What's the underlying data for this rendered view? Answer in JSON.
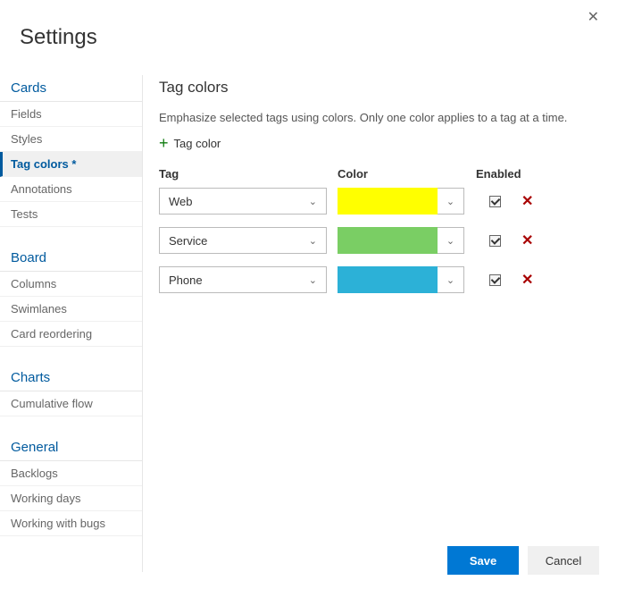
{
  "header": {
    "title": "Settings"
  },
  "close_icon": "✕",
  "sidebar": {
    "sections": [
      {
        "title": "Cards",
        "items": [
          {
            "label": "Fields",
            "active": false
          },
          {
            "label": "Styles",
            "active": false
          },
          {
            "label": "Tag colors *",
            "active": true
          },
          {
            "label": "Annotations",
            "active": false
          },
          {
            "label": "Tests",
            "active": false
          }
        ]
      },
      {
        "title": "Board",
        "items": [
          {
            "label": "Columns",
            "active": false
          },
          {
            "label": "Swimlanes",
            "active": false
          },
          {
            "label": "Card reordering",
            "active": false
          }
        ]
      },
      {
        "title": "Charts",
        "items": [
          {
            "label": "Cumulative flow",
            "active": false
          }
        ]
      },
      {
        "title": "General",
        "items": [
          {
            "label": "Backlogs",
            "active": false
          },
          {
            "label": "Working days",
            "active": false
          },
          {
            "label": "Working with bugs",
            "active": false
          }
        ]
      }
    ]
  },
  "main": {
    "title": "Tag colors",
    "description": "Emphasize selected tags using colors. Only one color applies to a tag at a time.",
    "add_label": "Tag color",
    "plus_icon": "+",
    "columns": {
      "tag": "Tag",
      "color": "Color",
      "enabled": "Enabled"
    },
    "rows": [
      {
        "tag": "Web",
        "color": "#ffff00",
        "enabled": true
      },
      {
        "tag": "Service",
        "color": "#7ace64",
        "enabled": true
      },
      {
        "tag": "Phone",
        "color": "#2cb1d7",
        "enabled": true
      }
    ],
    "chevron": "⌄",
    "delete_icon": "✕"
  },
  "footer": {
    "save_label": "Save",
    "cancel_label": "Cancel"
  }
}
